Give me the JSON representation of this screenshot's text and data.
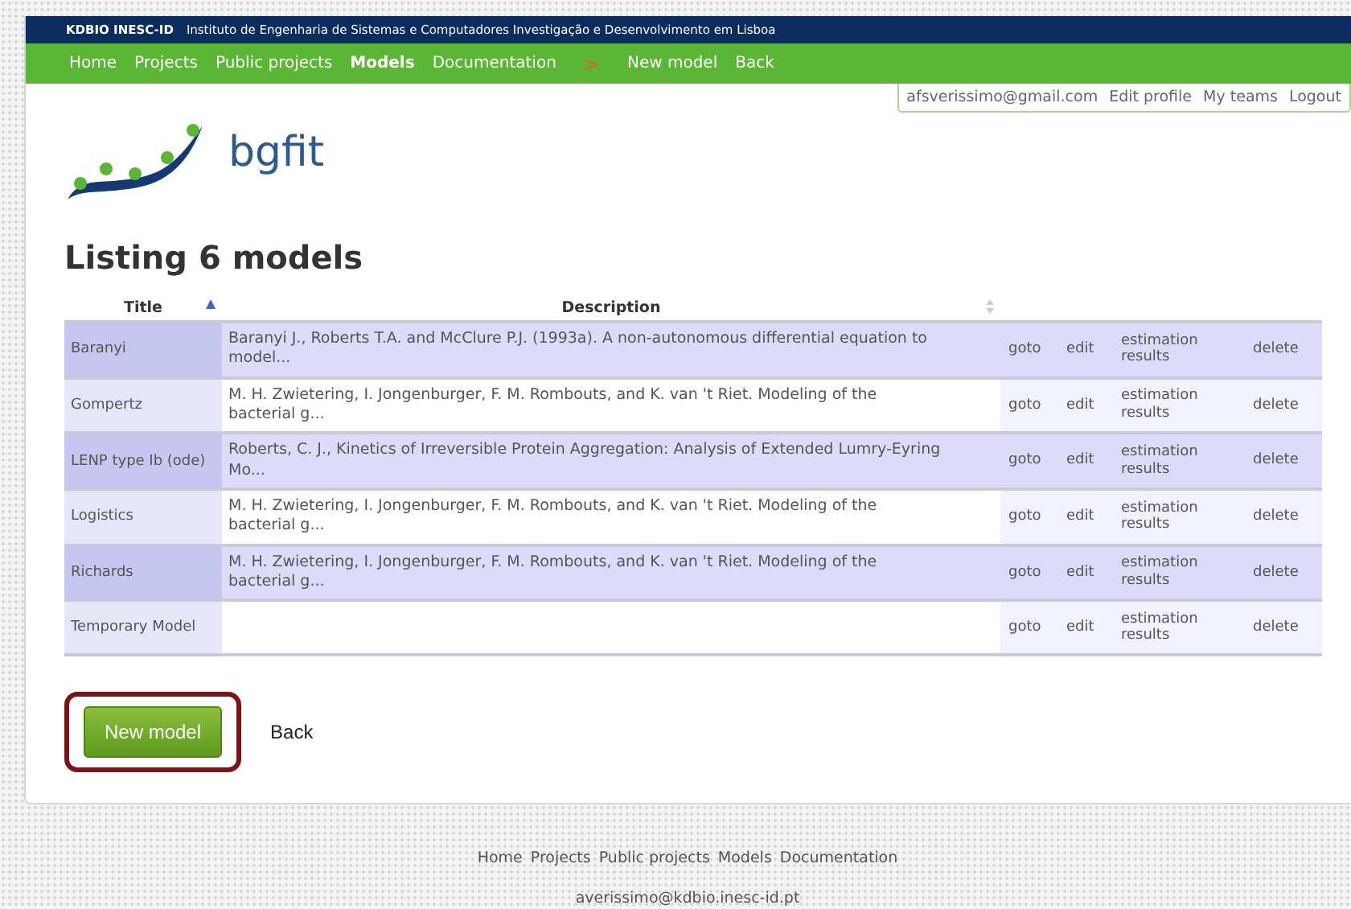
{
  "header": {
    "brand": "KDBIO INESC-ID",
    "institute": "Instituto de Engenharia de Sistemas e Computadores Investigação e Desenvolvimento em Lisboa"
  },
  "nav": {
    "items": [
      {
        "label": "Home",
        "selected": false
      },
      {
        "label": "Projects",
        "selected": false
      },
      {
        "label": "Public projects",
        "selected": false
      },
      {
        "label": "Models",
        "selected": true
      },
      {
        "label": "Documentation",
        "selected": false
      }
    ],
    "separator": ">",
    "actions": [
      "New model",
      "Back"
    ]
  },
  "user_menu": [
    "afsverissimo@gmail.com",
    "Edit profile",
    "My teams",
    "Logout"
  ],
  "logo": {
    "text": "bgfit"
  },
  "heading": "Listing 6 models",
  "table": {
    "columns": [
      {
        "label": "Title",
        "sorted": true
      },
      {
        "label": "Description",
        "sorted": false
      }
    ],
    "rows": [
      {
        "title": "Baranyi",
        "description": "Baranyi J., Roberts T.A. and McClure P.J. (1993a). A non-autonomous differential equation to model...",
        "actions": [
          "goto",
          "edit",
          "estimation results",
          "delete"
        ]
      },
      {
        "title": "Gompertz",
        "description": "M. H. Zwietering, I. Jongenburger, F. M. Rombouts, and K. van 't Riet. Modeling of the bacterial g...",
        "actions": [
          "goto",
          "edit",
          "estimation results",
          "delete"
        ]
      },
      {
        "title": "LENP type Ib (ode)",
        "description": "Roberts, C. J., Kinetics of Irreversible Protein Aggregation: Analysis of Extended Lumry-Eyring Mo...",
        "actions": [
          "goto",
          "edit",
          "estimation results",
          "delete"
        ]
      },
      {
        "title": "Logistics",
        "description": "M. H. Zwietering, I. Jongenburger, F. M. Rombouts, and K. van 't Riet. Modeling of the bacterial g...",
        "actions": [
          "goto",
          "edit",
          "estimation results",
          "delete"
        ]
      },
      {
        "title": "Richards",
        "description": "M. H. Zwietering, I. Jongenburger, F. M. Rombouts, and K. van 't Riet. Modeling of the bacterial g...",
        "actions": [
          "goto",
          "edit",
          "estimation results",
          "delete"
        ]
      },
      {
        "title": "Temporary Model",
        "description": "",
        "actions": [
          "goto",
          "edit",
          "estimation results",
          "delete"
        ]
      }
    ]
  },
  "buttons": {
    "primary": "New model",
    "secondary": "Back"
  },
  "footer": {
    "links": [
      "Home",
      "Projects",
      "Public projects",
      "Models",
      "Documentation"
    ],
    "email": "averissimo@kdbio.inesc-id.pt"
  }
}
